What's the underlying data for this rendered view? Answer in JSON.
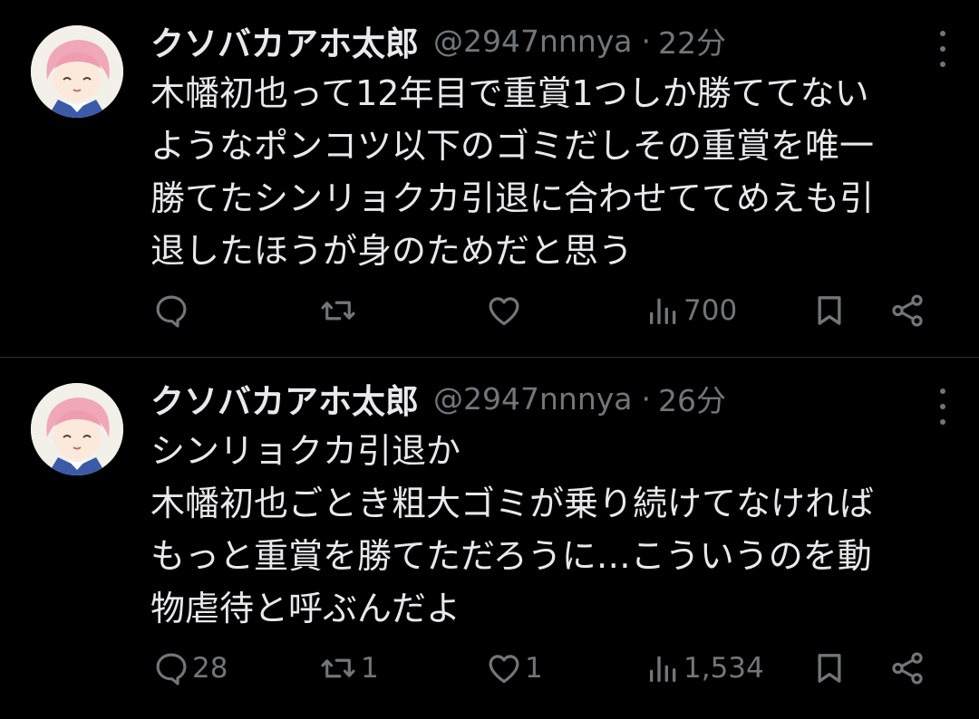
{
  "tweets": [
    {
      "name": "クソバカアホ太郎",
      "handle": "@2947nnnya",
      "dot": "·",
      "time": "22分",
      "lines": [
        "木幡初也って12年目で重賞1つしか勝ててない",
        "ようなポンコツ以下のゴミだしその重賞を唯一",
        "勝てたシンリョクカ引退に合わせててめえも引",
        "退したほうが身のためだと思う"
      ],
      "replies": "",
      "retweets": "",
      "likes": "",
      "views": "700"
    },
    {
      "name": "クソバカアホ太郎",
      "handle": "@2947nnnya",
      "dot": "·",
      "time": "26分",
      "lines": [
        "シンリョクカ引退か",
        "木幡初也ごとき粗大ゴミが乗り続けてなければ",
        "もっと重賞を勝てただろうに…こういうのを動",
        "物虐待と呼ぶんだよ"
      ],
      "replies": "28",
      "retweets": "1",
      "likes": "1",
      "views": "1,534"
    }
  ],
  "icons": {
    "reply": "reply-icon",
    "retweet": "retweet-icon",
    "like": "heart-icon",
    "views": "views-icon",
    "bookmark": "bookmark-icon",
    "share": "share-icon",
    "more": "more-dots-icon"
  },
  "colors": {
    "background": "#000000",
    "text": "#e7e9ea",
    "muted": "#71767b",
    "divider": "#2f3336"
  }
}
